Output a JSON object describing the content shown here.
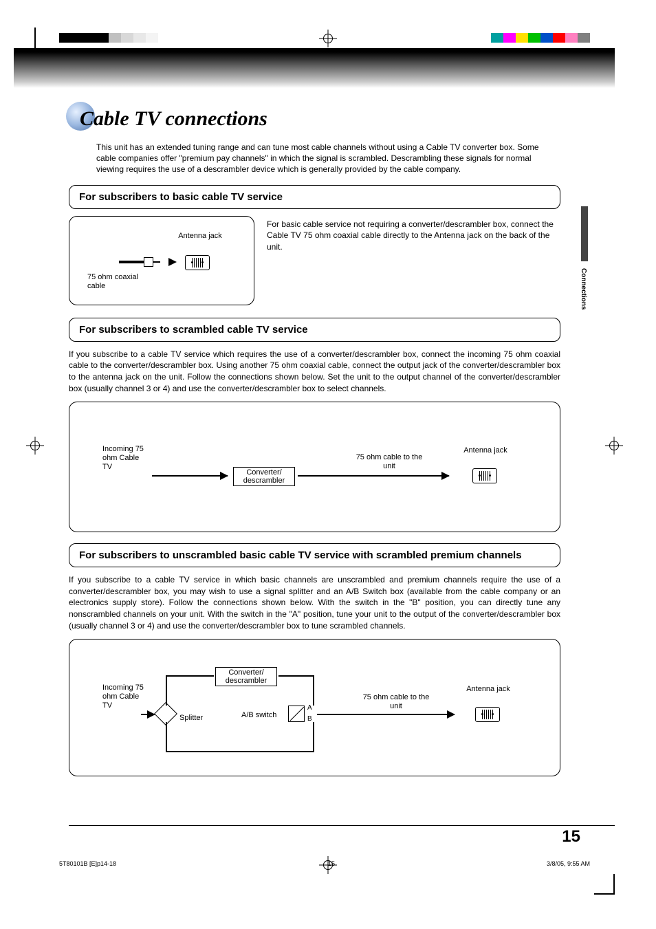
{
  "title": "Cable TV connections",
  "intro": "This unit has an extended tuning range and can tune most cable channels without using a Cable TV converter box. Some cable companies offer \"premium pay channels\" in which the signal is scrambled. Descrambling these signals for normal viewing requires the use of a descrambler device which is generally provided by the cable company.",
  "side_tab": "Connections",
  "sec1": {
    "title": "For subscribers to basic cable TV service",
    "para": "For basic cable service not requiring a converter/descrambler box, connect the Cable TV 75 ohm coaxial cable directly to the Antenna jack on the back of the unit.",
    "label_antenna": "Antenna jack",
    "label_coax": "75 ohm coaxial cable"
  },
  "sec2": {
    "title": "For subscribers to scrambled cable TV service",
    "para": "If you subscribe to a cable TV service which requires the use of a converter/descrambler box, connect the incoming 75 ohm coaxial cable to the converter/descrambler box. Using another 75 ohm coaxial cable, connect the output jack of the converter/descrambler box to the antenna jack on the unit. Follow the connections shown below. Set the unit to the output channel of the converter/descrambler box (usually channel 3 or 4) and use the converter/descrambler box to select channels.",
    "label_incoming": "Incoming 75 ohm Cable TV",
    "label_conv": "Converter/ descrambler",
    "label_to_unit": "75 ohm cable to the unit",
    "label_antenna": "Antenna jack"
  },
  "sec3": {
    "title": "For subscribers to unscrambled basic cable TV service with scrambled premium channels",
    "para": "If you subscribe to a cable TV service in which basic channels are unscrambled and premium channels require the use of a converter/descrambler box, you may wish to use a signal splitter and an A/B Switch box (available from the cable company or an electronics supply store). Follow the connections shown below. With the switch in the \"B\" position, you can directly tune any nonscrambled channels on your unit. With the switch in the \"A\" position, tune your unit to the output of the converter/descrambler box (usually channel 3 or 4) and use the converter/descrambler box to tune scrambled channels.",
    "label_incoming": "Incoming 75 ohm Cable TV",
    "label_conv": "Converter/ descrambler",
    "label_splitter": "Splitter",
    "label_ab": "A/B switch",
    "label_a": "A",
    "label_b": "B",
    "label_to_unit": "75 ohm cable to the unit",
    "label_antenna": "Antenna jack"
  },
  "page_number": "15",
  "footer": {
    "file": "5T80101B [E]p14-18",
    "pg": "15",
    "date": "3/8/05, 9:55 AM"
  },
  "colors_left": [
    "#000000",
    "#000000",
    "#000000",
    "#000000",
    "#c0c0c0",
    "#d8d8d8",
    "#e8e8e8",
    "#f4f4f4",
    "#ffffff",
    "#ffffff",
    "#ffffff",
    "#ffffff"
  ],
  "colors_right": [
    "#00a0a0",
    "#ff00ff",
    "#ffe000",
    "#00c000",
    "#0050c8",
    "#ff0000",
    "#ff80c0",
    "#808080"
  ]
}
